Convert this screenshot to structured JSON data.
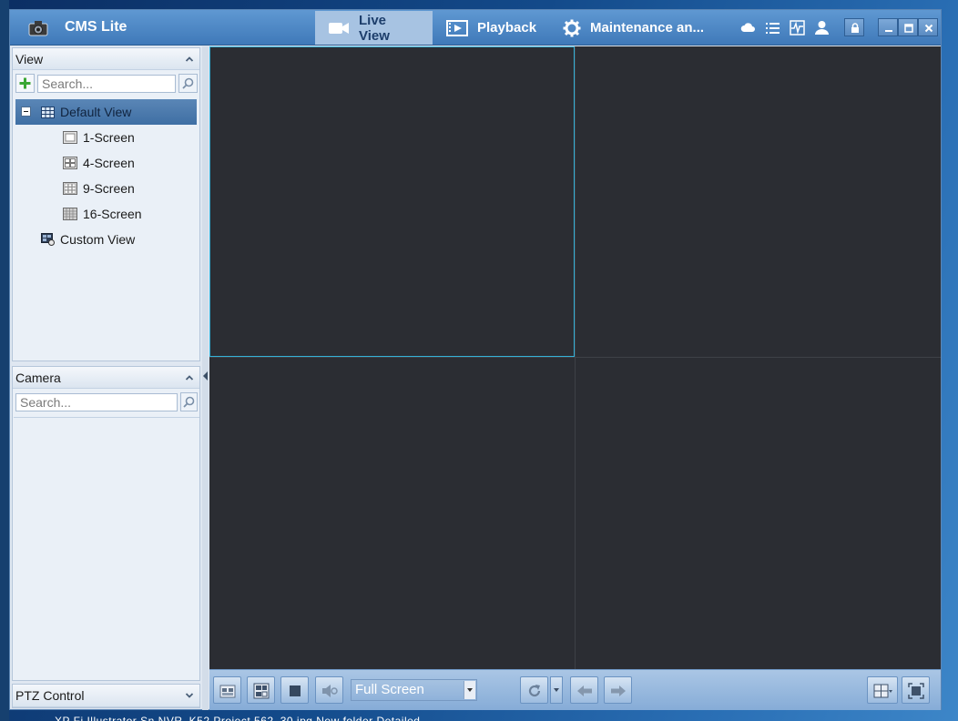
{
  "app": {
    "title": "CMS Lite"
  },
  "nav": {
    "tabs": [
      {
        "label": "Live View",
        "icon": "camera-icon",
        "active": true
      },
      {
        "label": "Playback",
        "icon": "playback-icon",
        "active": false
      },
      {
        "label": "Maintenance an...",
        "icon": "gear-icon",
        "active": false
      }
    ],
    "tool_icons": [
      "cloud-icon",
      "list-icon",
      "activity-icon",
      "user-icon"
    ],
    "window_controls": [
      "lock-icon",
      "minimize-icon",
      "maximize-icon",
      "close-icon"
    ]
  },
  "view_panel": {
    "title": "View",
    "search": {
      "placeholder": "Search..."
    },
    "tree": {
      "default_view": "Default View",
      "items": [
        "1-Screen",
        "4-Screen",
        "9-Screen",
        "16-Screen"
      ],
      "custom_view": "Custom View"
    }
  },
  "camera_panel": {
    "title": "Camera",
    "search": {
      "placeholder": "Search..."
    }
  },
  "ptz_panel": {
    "title": "PTZ Control"
  },
  "video": {
    "layout": "4-Screen",
    "active_cell": 0
  },
  "toolbar": {
    "stream_mode": "Full Screen"
  },
  "desktop": {
    "taskbar_partial_text": "XP         Fi             Illustrator   Sn   NVR_K52  Project  562_30.jpg   New folder       Detailed"
  },
  "colors": {
    "titlebar": "#4a86c5",
    "active_tab": "#a7c3e2",
    "cell_highlight": "#34b1d8",
    "video_bg": "#2b2d33"
  }
}
